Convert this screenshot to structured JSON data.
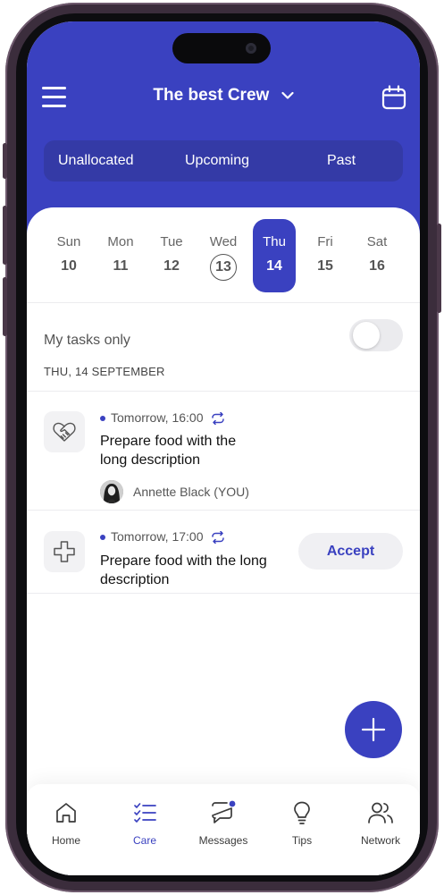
{
  "header": {
    "title": "The best Crew",
    "menu_icon": "hamburger-icon",
    "calendar_icon": "calendar-icon"
  },
  "segments": [
    {
      "label": "Unallocated"
    },
    {
      "label": "Upcoming"
    },
    {
      "label": "Past"
    }
  ],
  "week": [
    {
      "day": "Sun",
      "date": "10",
      "state": "normal"
    },
    {
      "day": "Mon",
      "date": "11",
      "state": "normal"
    },
    {
      "day": "Tue",
      "date": "12",
      "state": "normal"
    },
    {
      "day": "Wed",
      "date": "13",
      "state": "today"
    },
    {
      "day": "Thu",
      "date": "14",
      "state": "selected"
    },
    {
      "day": "Fri",
      "date": "15",
      "state": "normal"
    },
    {
      "day": "Sat",
      "date": "16",
      "state": "normal"
    }
  ],
  "filter": {
    "label": "My tasks only",
    "enabled": false
  },
  "date_heading": "THU, 14 SEPTEMBER",
  "tasks": [
    {
      "time": "Tomorrow, 16:00",
      "title_line1": "Prepare food with the",
      "title_line2": "long description",
      "assignee": "Annette Black (YOU)",
      "icon": "heart-handshake-icon",
      "recurring": true
    },
    {
      "time": "Tomorrow, 17:00",
      "title_line1": "Prepare food with the long",
      "title_line2": "description",
      "action": "Accept",
      "icon": "medical-cross-icon",
      "recurring": true
    }
  ],
  "tabbar": [
    {
      "label": "Home",
      "icon": "home-icon",
      "active": false
    },
    {
      "label": "Care",
      "icon": "checklist-icon",
      "active": true
    },
    {
      "label": "Messages",
      "icon": "message-icon",
      "active": false,
      "badge": true
    },
    {
      "label": "Tips",
      "icon": "lightbulb-icon",
      "active": false
    },
    {
      "label": "Network",
      "icon": "people-icon",
      "active": false
    }
  ],
  "colors": {
    "accent": "#3a41c0",
    "header": "#3a41c0",
    "segment_bg": "#343aa6"
  }
}
